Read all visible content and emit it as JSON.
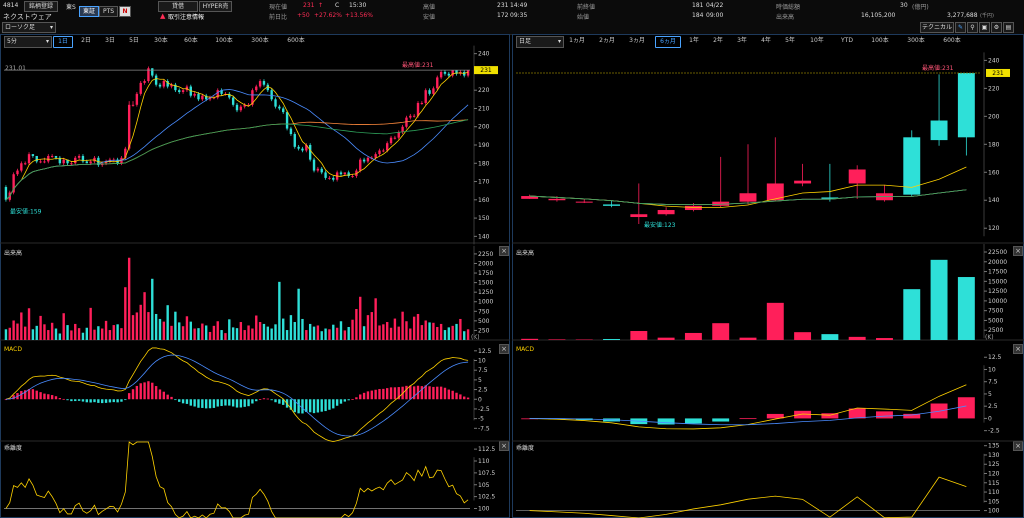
{
  "header": {
    "code": "4814",
    "register_btn": "銘柄登録",
    "market": "東S",
    "tab_primary": "東証",
    "tab_pts": "PTS",
    "news_icon": "N",
    "company": "ネクストウェア",
    "credit_btn": "貸借",
    "hyper_btn": "HYPER売",
    "warning": "取引注意情報",
    "price_label": "現在値",
    "price": "231",
    "price_arrow": "↑",
    "price_flag": "C",
    "price_time": "15:30",
    "prev_label": "前日比",
    "change": "+50",
    "change_pct": "+27.62%",
    "change_pct2": "+13.56%",
    "high_label": "高値",
    "high": "231",
    "high_time": "14:49",
    "low_label": "安値",
    "low": "172",
    "low_time": "09:35",
    "prevclose_label": "前終値",
    "prevclose": "181",
    "prevclose_date": "04/22",
    "open_label": "始値",
    "open": "184",
    "open_time": "09:00",
    "mcap_label": "時価総額",
    "mcap": "30",
    "mcap_unit": "(億円)",
    "volume_label": "出来高",
    "volume": "16,105,200",
    "turnover": "3,277,688",
    "turnover_unit": "(千円)",
    "tech_btn": "テクニカル",
    "chart_style": "ローソク足"
  },
  "left": {
    "interval": "5分",
    "tabs": [
      "1日",
      "2日",
      "3日",
      "5日",
      "30本",
      "60本",
      "100本",
      "300本",
      "600本"
    ],
    "selected_tab": "1日",
    "price_ref": "231.01",
    "price_tag": "231",
    "max_label": "最高値:231",
    "min_label": "最安値:159"
  },
  "right": {
    "interval": "日足",
    "tabs": [
      "1ヵ月",
      "2ヵ月",
      "3ヵ月",
      "6ヵ月",
      "1年",
      "2年",
      "3年",
      "4年",
      "5年",
      "10年",
      "YTD",
      "100本",
      "300本",
      "600本"
    ],
    "selected_tab": "6ヵ月",
    "price_tag": "231",
    "max_label": "最高値:231",
    "min_label": "最安値:123"
  },
  "subpanels": {
    "volume": "出来高",
    "macd": "MACD",
    "deviation": "乖離度",
    "unit_k": "(K)"
  },
  "colors": {
    "up": "#ff1f5a",
    "down": "#2ee0d8"
  },
  "chart_data": [
    {
      "type": "candlestick",
      "interval": "5分",
      "ylim": [
        138,
        242
      ],
      "y_ticks": [
        140,
        150,
        160,
        170,
        180,
        190,
        200,
        210,
        220,
        230,
        240
      ],
      "open": [
        167,
        160,
        164,
        174,
        176,
        180,
        180,
        185,
        184,
        181,
        181,
        181,
        184,
        184,
        183,
        180,
        182,
        180,
        180,
        183,
        184,
        181,
        180,
        181,
        183,
        179,
        180,
        181,
        182,
        182,
        180,
        183,
        188,
        212,
        212,
        218,
        224,
        225,
        232,
        228,
        223,
        222,
        225,
        222,
        223,
        220,
        219,
        220,
        222,
        217,
        218,
        215,
        217,
        215,
        216,
        216,
        220,
        218,
        218,
        216,
        212,
        209,
        211,
        212,
        212,
        220,
        222,
        225,
        223,
        220,
        215,
        211,
        210,
        208,
        199,
        196,
        189,
        188,
        187,
        190,
        182,
        176,
        177,
        175,
        172,
        172,
        171,
        175,
        174,
        175,
        173,
        173,
        176,
        182,
        181,
        183,
        183,
        185,
        187,
        187,
        191,
        194,
        194,
        197,
        200,
        205,
        206,
        206,
        213,
        213,
        220,
        218,
        221,
        227,
        230,
        229,
        228,
        231,
        229,
        230,
        228
      ],
      "close": [
        160,
        164,
        174,
        176,
        180,
        180,
        185,
        184,
        181,
        181,
        181,
        184,
        184,
        183,
        180,
        182,
        180,
        180,
        183,
        184,
        181,
        180,
        181,
        183,
        179,
        180,
        181,
        182,
        182,
        180,
        183,
        188,
        212,
        212,
        218,
        224,
        225,
        232,
        228,
        223,
        222,
        225,
        222,
        223,
        220,
        219,
        220,
        222,
        217,
        218,
        215,
        217,
        215,
        216,
        216,
        220,
        218,
        218,
        216,
        212,
        209,
        211,
        212,
        212,
        220,
        222,
        225,
        223,
        220,
        215,
        211,
        210,
        208,
        199,
        196,
        189,
        188,
        187,
        190,
        182,
        176,
        177,
        175,
        172,
        172,
        171,
        175,
        174,
        175,
        173,
        173,
        176,
        182,
        181,
        183,
        183,
        185,
        187,
        187,
        191,
        194,
        194,
        197,
        200,
        205,
        206,
        206,
        213,
        213,
        220,
        218,
        221,
        227,
        230,
        229,
        228,
        231,
        229,
        230,
        228,
        231
      ],
      "high": [
        168,
        165,
        175,
        177,
        181,
        181,
        186,
        185,
        183,
        182,
        183,
        185,
        185,
        184,
        184,
        183,
        181,
        181,
        184,
        185,
        185,
        182,
        182,
        184,
        184,
        181,
        182,
        183,
        183,
        183,
        184,
        189,
        214,
        214,
        219,
        225,
        226,
        233,
        232,
        229,
        224,
        226,
        226,
        224,
        224,
        221,
        221,
        223,
        223,
        219,
        219,
        218,
        218,
        217,
        217,
        221,
        221,
        219,
        219,
        217,
        213,
        212,
        213,
        213,
        221,
        223,
        226,
        226,
        224,
        221,
        216,
        212,
        211,
        209,
        200,
        197,
        190,
        189,
        191,
        191,
        183,
        178,
        178,
        176,
        173,
        173,
        176,
        176,
        175,
        176,
        174,
        177,
        183,
        183,
        184,
        184,
        186,
        188,
        188,
        192,
        195,
        195,
        198,
        201,
        206,
        207,
        207,
        214,
        214,
        221,
        221,
        222,
        228,
        231,
        231,
        230,
        231,
        231,
        231,
        231,
        231
      ],
      "low": [
        159,
        159,
        163,
        173,
        175,
        179,
        179,
        183,
        180,
        180,
        180,
        180,
        183,
        182,
        179,
        179,
        179,
        179,
        179,
        182,
        180,
        180,
        179,
        180,
        178,
        178,
        179,
        180,
        181,
        179,
        179,
        182,
        187,
        211,
        211,
        217,
        223,
        224,
        227,
        222,
        221,
        221,
        221,
        221,
        219,
        218,
        218,
        219,
        216,
        216,
        214,
        214,
        214,
        214,
        215,
        215,
        217,
        217,
        215,
        211,
        208,
        208,
        210,
        211,
        211,
        219,
        221,
        222,
        219,
        214,
        210,
        209,
        207,
        198,
        195,
        188,
        187,
        186,
        186,
        181,
        175,
        175,
        174,
        171,
        171,
        170,
        170,
        173,
        173,
        172,
        172,
        172,
        175,
        180,
        180,
        182,
        182,
        184,
        186,
        186,
        190,
        193,
        193,
        196,
        199,
        204,
        205,
        205,
        212,
        212,
        217,
        217,
        220,
        226,
        228,
        227,
        227,
        228,
        228,
        227,
        227
      ]
    },
    {
      "type": "candlestick",
      "interval": "日足",
      "ylim": [
        113,
        246
      ],
      "y_ticks": [
        120,
        140,
        160,
        180,
        200,
        220,
        240
      ],
      "open": [
        141,
        140,
        139,
        137,
        128,
        130,
        133,
        136,
        139,
        140,
        152,
        142,
        152,
        140,
        185,
        197,
        231
      ],
      "close": [
        143,
        141,
        139,
        136,
        130,
        133,
        136,
        139,
        145,
        152,
        154,
        141,
        162,
        145,
        144,
        183,
        185
      ],
      "high": [
        144,
        143,
        141,
        140,
        152,
        135,
        138,
        171,
        180,
        185,
        166,
        166,
        165,
        151,
        190,
        230,
        231
      ],
      "low": [
        141,
        139,
        138,
        135,
        123,
        129,
        132,
        135,
        137,
        139,
        150,
        139,
        141,
        139,
        143,
        179,
        172
      ]
    },
    {
      "type": "bar",
      "name": "出来高 5分",
      "ylim": [
        0,
        2300
      ],
      "y_ticks": [
        250,
        500,
        750,
        1000,
        1250,
        1500,
        1750,
        2000,
        2250
      ],
      "values": [
        280,
        320,
        510,
        430,
        720,
        350,
        830,
        280,
        370,
        630,
        410,
        260,
        450,
        300,
        170,
        700,
        390,
        250,
        420,
        310,
        190,
        320,
        840,
        270,
        360,
        300,
        500,
        260,
        390,
        410,
        310,
        1380,
        2150,
        650,
        720,
        920,
        1250,
        730,
        1600,
        680,
        550,
        480,
        910,
        370,
        740,
        460,
        360,
        620,
        480,
        300,
        310,
        430,
        380,
        210,
        370,
        490,
        260,
        180,
        540,
        330,
        310,
        470,
        260,
        380,
        300,
        640,
        470,
        420,
        350,
        300,
        410,
        1520,
        560,
        260,
        650,
        470,
        1340,
        550,
        260,
        420,
        350,
        380,
        230,
        300,
        280,
        400,
        320,
        490,
        250,
        340,
        530,
        810,
        1130,
        360,
        650,
        730,
        1090,
        380,
        410,
        470,
        320,
        560,
        350,
        740,
        490,
        300,
        610,
        680,
        390,
        510,
        460,
        450,
        340,
        420,
        260,
        330,
        370,
        420,
        550,
        230,
        280
      ]
    },
    {
      "type": "bar",
      "name": "出来高 日足",
      "ylim": [
        0,
        22500
      ],
      "y_ticks": [
        2500,
        5000,
        7500,
        10000,
        12500,
        15000,
        17500,
        20000,
        22500
      ],
      "values": [
        300,
        150,
        120,
        250,
        2300,
        600,
        1800,
        4300,
        600,
        9500,
        2000,
        1500,
        800,
        500,
        13000,
        20500,
        16100
      ]
    }
  ]
}
